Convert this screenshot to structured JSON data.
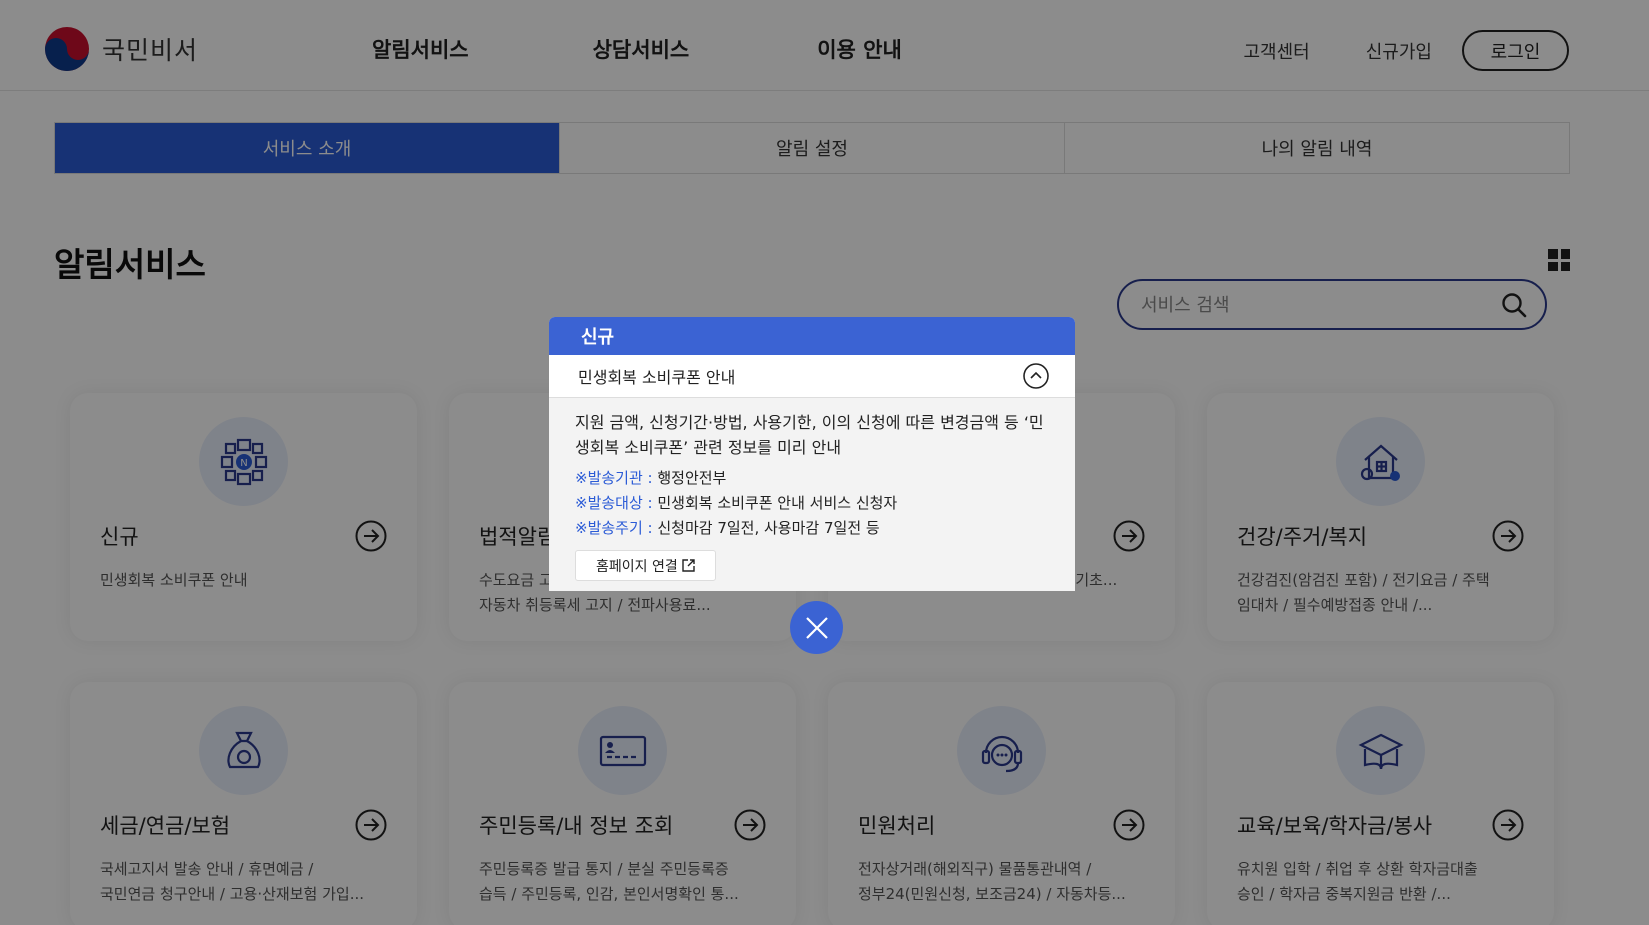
{
  "header": {
    "logo_text": "국민비서",
    "nav": [
      "알림서비스",
      "상담서비스",
      "이용 안내"
    ],
    "util": [
      "고객센터",
      "신규가입"
    ],
    "login_label": "로그인"
  },
  "tabs": [
    {
      "label": "서비스 소개",
      "active": true
    },
    {
      "label": "알림 설정",
      "active": false
    },
    {
      "label": "나의 알림 내역",
      "active": false
    }
  ],
  "main": {
    "title": "알림서비스",
    "search_placeholder": "서비스 검색"
  },
  "cards": [
    {
      "title": "신규",
      "desc": [
        "민생회복 소비쿠폰 안내",
        ""
      ],
      "icon": "new-badge-icon"
    },
    {
      "title": "법적알림",
      "desc": [
        "수도요금 고",
        "자동차 취등록세 고지  / 전파사용료..."
      ],
      "icon": "legal-icon"
    },
    {
      "title": "",
      "desc": [
        "",
        "고액현금거래 제공사실 통보  / 국민기초..."
      ],
      "icon": "finance-icon"
    },
    {
      "title": "건강/주거/복지",
      "desc": [
        "건강검진(암검진 포함)  / 전기요금  / 주택",
        "임대차  / 필수예방접종 안내  /..."
      ],
      "icon": "house-icon"
    },
    {
      "title": "세금/연금/보험",
      "desc": [
        "국세고지서 발송 안내  / 휴면예금  /",
        "국민연금 청구안내  / 고용·산재보험 가입..."
      ],
      "icon": "money-bag-icon"
    },
    {
      "title": "주민등록/내 정보 조회",
      "desc": [
        "주민등록증 발급 통지  / 분실 주민등록증",
        "습득  / 주민등록, 인감, 본인서명확인 통..."
      ],
      "icon": "id-card-icon"
    },
    {
      "title": "민원처리",
      "desc": [
        "전자상거래(해외직구) 물품통관내역  /",
        "정부24(민원신청, 보조금24)  / 자동차등..."
      ],
      "icon": "headset-icon"
    },
    {
      "title": "교육/보육/학자금/봉사",
      "desc": [
        "유치원 입학  / 취업 후 상환 학자금대출",
        "승인  / 학자금 중복지원금 반환  /..."
      ],
      "icon": "school-icon"
    }
  ],
  "modal": {
    "header": "신규",
    "subtitle": "민생회복 소비쿠폰 안내",
    "description": "지원 금액, 신청기간·방법, 사용기한, 이의 신청에 따른 변경금액 등 ‘민생회복 소비쿠폰’ 관련 정보를 미리 안내",
    "meta": [
      {
        "key": "※발송기관 : ",
        "value": "행정안전부"
      },
      {
        "key": "※발송대상 : ",
        "value": "민생회복 소비쿠폰 안내 서비스 신청자"
      },
      {
        "key": "※발송주기 : ",
        "value": "신청마감 7일전, 사용마감 7일전 등"
      }
    ],
    "home_button": "홈페이지 연결"
  },
  "colors": {
    "primary": "#2b5bd6",
    "modal_header": "#3b63d3",
    "icon_bg": "#e8eefc"
  }
}
